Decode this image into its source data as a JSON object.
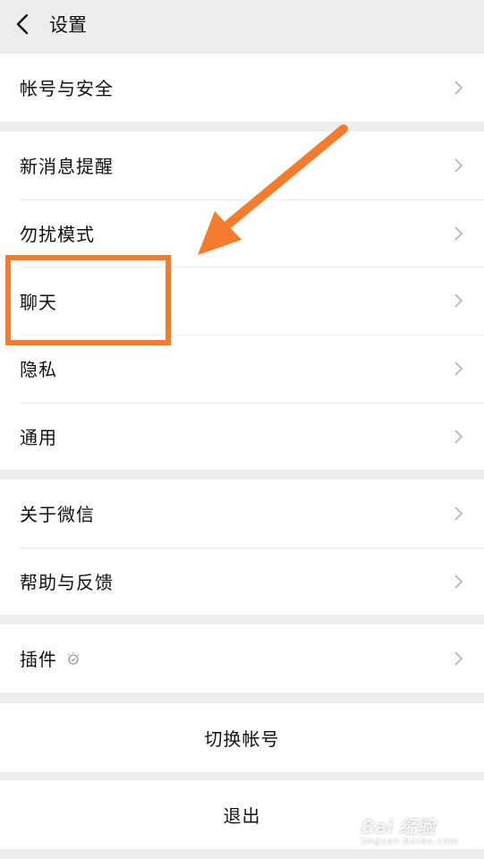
{
  "header": {
    "title": "设置",
    "back_icon": "chevron-left-icon"
  },
  "groups": [
    {
      "items": [
        "帐号与安全"
      ]
    },
    {
      "items": [
        "新消息提醒",
        "勿扰模式",
        "聊天",
        "隐私",
        "通用"
      ]
    },
    {
      "items": [
        "关于微信",
        "帮助与反馈"
      ]
    },
    {
      "items": [
        "插件"
      ]
    }
  ],
  "plugin_badge_icon": "bulb-icon",
  "actions": {
    "switch_account": "切换帐号",
    "logout": "退出"
  },
  "annotation": {
    "highlight_color": "#f47c2c",
    "highlight_target": "聊天"
  },
  "watermark": {
    "main": "Bai 经验",
    "sub": "jingyan.baidu.com"
  }
}
